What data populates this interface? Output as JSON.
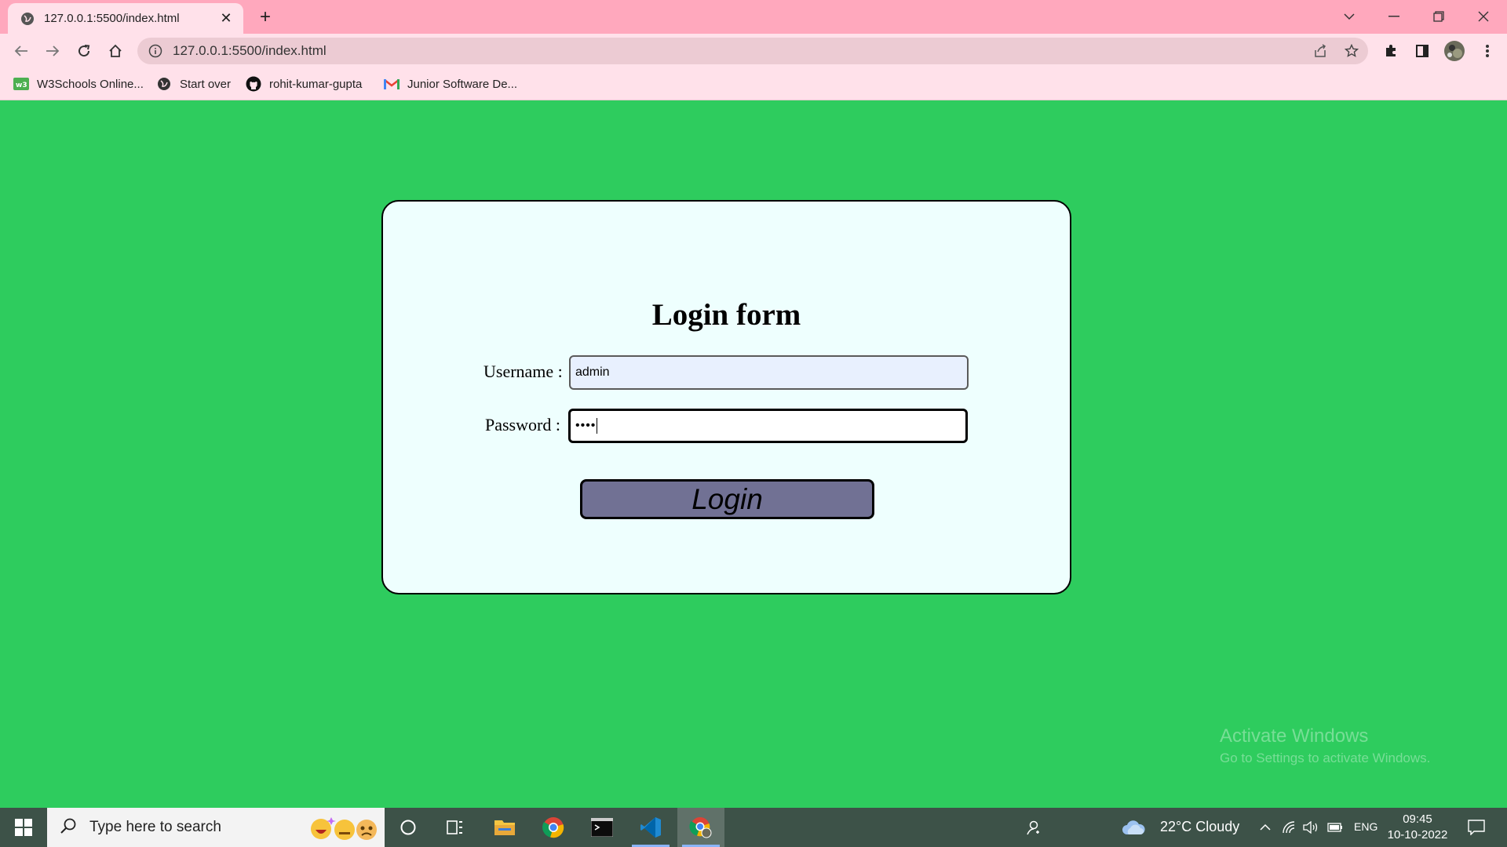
{
  "browser": {
    "tab_title": "127.0.0.1:5500/index.html",
    "url": "127.0.0.1:5500/index.html"
  },
  "bookmarks": [
    {
      "label": "W3Schools Online...",
      "icon": "w3schools-icon"
    },
    {
      "label": "Start over",
      "icon": "globe-icon"
    },
    {
      "label": "rohit-kumar-gupta",
      "icon": "github-icon"
    },
    {
      "label": "Junior Software De...",
      "icon": "gmail-icon"
    }
  ],
  "form": {
    "title": "Login form",
    "username_label": "Username :",
    "username_value": "admin",
    "password_label": "Password :",
    "password_value": "••••",
    "login_label": "Login"
  },
  "watermark": {
    "line1": "Activate Windows",
    "line2": "Go to Settings to activate Windows."
  },
  "taskbar": {
    "search_placeholder": "Type here to search",
    "weather": "22°C  Cloudy",
    "language": "ENG",
    "time": "09:45",
    "date": "10-10-2022"
  },
  "colors": {
    "page_background": "#2ecc5e",
    "card_background": "#eefffe",
    "button_background": "#717194",
    "tab_strip": "#ffa8bd"
  }
}
